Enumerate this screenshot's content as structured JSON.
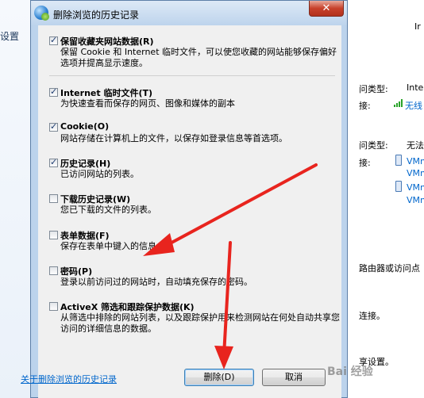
{
  "background_left": {
    "label": "设置"
  },
  "background_right": {
    "top_label": "Ir",
    "rows": [
      {
        "label": "问类型:",
        "value": "Inte"
      },
      {
        "label": "接:",
        "value": "无线"
      },
      {
        "label": "问类型:",
        "value": "无法"
      },
      {
        "label": "接:",
        "value": "VMn"
      },
      {
        "label": "",
        "value": "VMn"
      },
      {
        "label": "",
        "value": "VMn"
      },
      {
        "label": "",
        "value": "VMn"
      }
    ],
    "text_router": "路由器或访问点",
    "text_connect": "连接。",
    "text_share": "享设置。"
  },
  "dialog": {
    "title": "删除浏览的历史记录",
    "close_glyph": "✕",
    "options": [
      {
        "title": "保留收藏夹网站数据(R)",
        "desc": "保留 Cookie 和 Internet 临时文件，可以使您收藏的网站能够保存偏好选项并提高显示速度。",
        "checked": true
      },
      {
        "title": "Internet 临时文件(T)",
        "desc": "为快速查看而保存的网页、图像和媒体的副本",
        "checked": true
      },
      {
        "title": "Cookie(O)",
        "desc": "网站存储在计算机上的文件，以保存如登录信息等首选项。",
        "checked": true
      },
      {
        "title": "历史记录(H)",
        "desc": "已访问网站的列表。",
        "checked": true
      },
      {
        "title": "下载历史记录(W)",
        "desc": "您已下载的文件的列表。",
        "checked": false
      },
      {
        "title": "表单数据(F)",
        "desc": "保存在表单中键入的信息。",
        "checked": false
      },
      {
        "title": "密码(P)",
        "desc": "登录以前访问过的网站时，自动填充保存的密码。",
        "checked": false
      },
      {
        "title": "ActiveX 筛选和跟踪保护数据(K)",
        "desc": "从筛选中排除的网站列表，以及跟踪保护用来检测网站在何处自动共享您访问的详细信息的数据。",
        "checked": false
      }
    ],
    "help_link": "关于删除浏览的历史记录",
    "delete_button": "删除(D)",
    "cancel_button": "取消"
  },
  "watermark": "Bai 经验"
}
